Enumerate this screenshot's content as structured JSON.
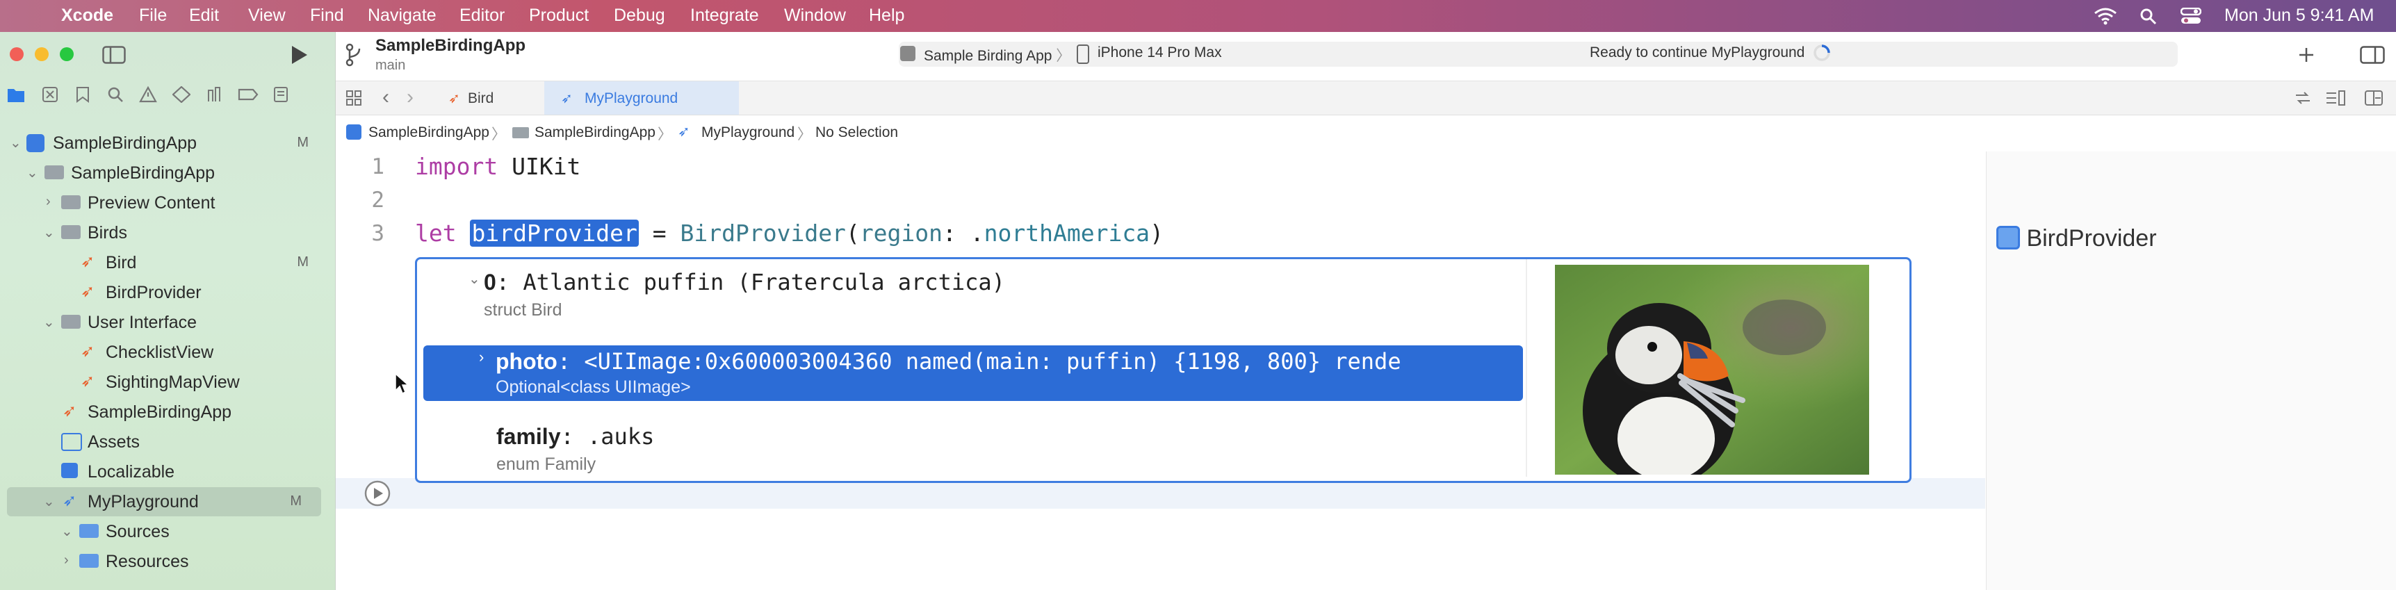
{
  "menubar": {
    "apple": "",
    "app": "Xcode",
    "items": [
      "File",
      "Edit",
      "View",
      "Find",
      "Navigate",
      "Editor",
      "Product",
      "Debug",
      "Integrate",
      "Window",
      "Help"
    ],
    "clock": "Mon Jun 5  9:41 AM"
  },
  "toolbar": {
    "project": "SampleBirdingApp",
    "branch": "main",
    "scheme": "Sample Birding App",
    "destination": "iPhone 14 Pro Max",
    "status": "Ready to continue MyPlayground"
  },
  "tabs": [
    {
      "label": "Bird"
    },
    {
      "label": "MyPlayground"
    }
  ],
  "jumpbar": [
    "SampleBirdingApp",
    "SampleBirdingApp",
    "MyPlayground",
    "No Selection"
  ],
  "navigator": [
    {
      "label": "SampleBirdingApp",
      "badge": "M"
    },
    {
      "label": "SampleBirdingApp",
      "badge": ""
    },
    {
      "label": "Preview Content",
      "badge": ""
    },
    {
      "label": "Birds",
      "badge": ""
    },
    {
      "label": "Bird",
      "badge": "M"
    },
    {
      "label": "BirdProvider",
      "badge": ""
    },
    {
      "label": "User Interface",
      "badge": ""
    },
    {
      "label": "ChecklistView",
      "badge": ""
    },
    {
      "label": "SightingMapView",
      "badge": ""
    },
    {
      "label": "SampleBirdingApp",
      "badge": ""
    },
    {
      "label": "Assets",
      "badge": ""
    },
    {
      "label": "Localizable",
      "badge": ""
    },
    {
      "label": "MyPlayground",
      "badge": "M"
    },
    {
      "label": "Sources",
      "badge": ""
    },
    {
      "label": "Resources",
      "badge": ""
    }
  ],
  "code": {
    "line_numbers": [
      "1",
      "2",
      "3"
    ],
    "line1_kw": "import",
    "line1_rest": " UIKit",
    "line3_kw": "let",
    "line3_var": "birdProvider",
    "line3_eq": " = ",
    "line3_type": "BirdProvider",
    "line3_open": "(",
    "line3_label": "region",
    "line3_colon": ": .",
    "line3_member": "northAmerica",
    "line3_close": ")"
  },
  "popover": {
    "row0_index": "0",
    "row0_value": ": Atlantic puffin (Fratercula arctica)",
    "row0_type": "struct Bird",
    "row1_name": "photo",
    "row1_value": ": <UIImage:0x600003004360 named(main: puffin) {1198, 800} rende",
    "row1_type": "Optional<class UIImage>",
    "row2_name": "family",
    "row2_value": ": .auks",
    "row2_type": "enum Family"
  },
  "canvas": {
    "result_label": "BirdProvider"
  }
}
